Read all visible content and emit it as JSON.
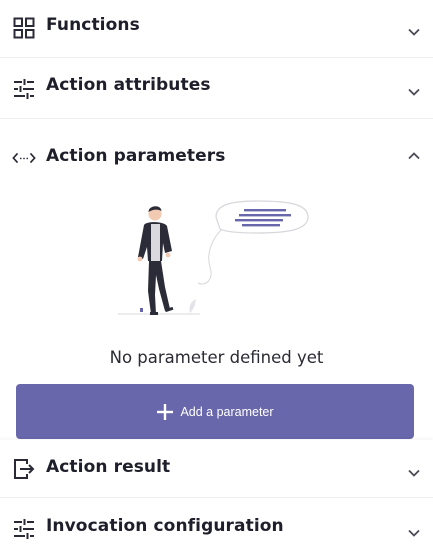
{
  "sections": {
    "functions": {
      "title": "Functions",
      "icon": "grid-icon",
      "expanded": false
    },
    "attributes": {
      "title": "Action attributes",
      "icon": "sliders-icon",
      "expanded": false
    },
    "parameters": {
      "title": "Action parameters",
      "icon": "code-brackets-icon",
      "expanded": true,
      "empty_text": "No parameter defined yet",
      "add_label": "Add a parameter"
    },
    "result": {
      "title": "Action result",
      "icon": "exit-box-icon",
      "expanded": false
    },
    "invocation": {
      "title": "Invocation configuration",
      "icon": "sliders-icon",
      "expanded": false
    }
  },
  "colors": {
    "accent": "#6967ab",
    "text": "#1f1f2b",
    "muted_icon": "#3a3a48"
  }
}
